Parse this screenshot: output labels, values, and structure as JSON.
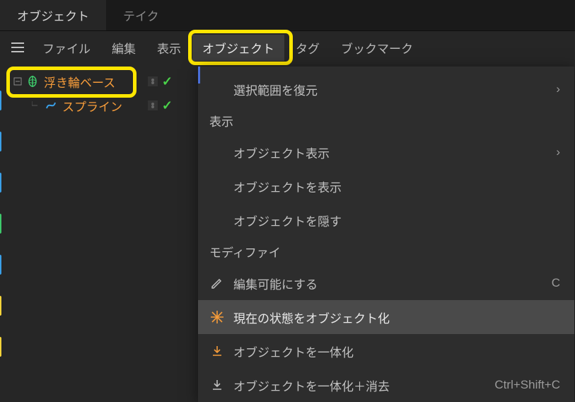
{
  "tabs": {
    "object": "オブジェクト",
    "take": "テイク"
  },
  "menubar": {
    "file": "ファイル",
    "edit": "編集",
    "view": "表示",
    "object": "オブジェクト",
    "tag": "タグ",
    "bookmark": "ブックマーク"
  },
  "outliner": {
    "items": [
      {
        "label": "浮き輪ベース",
        "icon": "lathe"
      },
      {
        "label": "スプライン",
        "icon": "spline"
      }
    ]
  },
  "context_menu": {
    "restore_selection": "選択範囲を復元",
    "section_display": "表示",
    "object_display": "オブジェクト表示",
    "show_objects": "オブジェクトを表示",
    "hide_objects": "オブジェクトを隠す",
    "section_modify": "モディファイ",
    "make_editable": "編集可能にする",
    "make_editable_shortcut": "C",
    "current_state_to_object": "現在の状態をオブジェクト化",
    "connect_objects": "オブジェクトを一体化",
    "connect_delete": "オブジェクトを一体化＋消去",
    "connect_delete_shortcut": "Ctrl+Shift+C"
  }
}
